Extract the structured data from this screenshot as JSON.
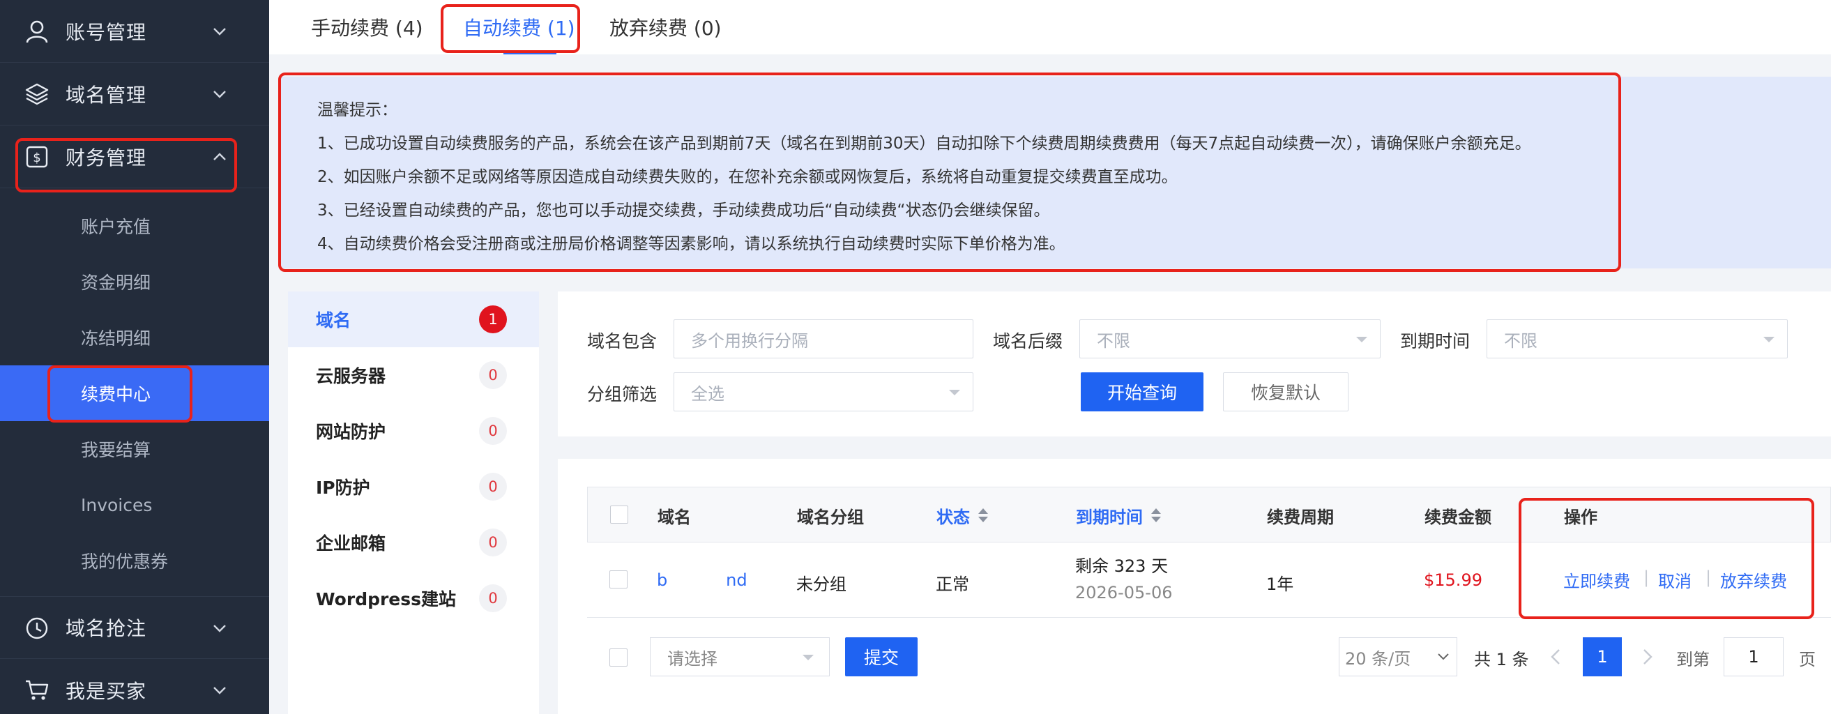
{
  "sidebar": {
    "sections": [
      {
        "label": "账号管理",
        "icon": "user-icon"
      },
      {
        "label": "域名管理",
        "icon": "layers-icon"
      },
      {
        "label": "财务管理",
        "icon": "finance-icon"
      },
      {
        "label": "域名抢注",
        "icon": "clock-icon"
      },
      {
        "label": "我是买家",
        "icon": "cart-icon"
      }
    ],
    "finance_items": [
      "账户充值",
      "资金明细",
      "冻结明细",
      "续费中心",
      "我要结算",
      "Invoices",
      "我的优惠券"
    ],
    "active_item": "续费中心"
  },
  "tabs": [
    {
      "label": "手动续费 (4)"
    },
    {
      "label": "自动续费 (1)"
    },
    {
      "label": "放弃续费 (0)"
    }
  ],
  "notice": {
    "title": "温馨提示：",
    "lines": [
      "1、已成功设置自动续费服务的产品，系统会在该产品到期前7天（域名在到期前30天）自动扣除下个续费周期续费费用（每天7点起自动续费一次），请确保账户余额充足。",
      "2、如因账户余额不足或网络等原因造成自动续费失败的，在您补充余额或网恢复后，系统将自动重复提交续费直至成功。",
      "3、已经设置自动续费的产品，您也可以手动提交续费，手动续费成功后“自动续费“状态仍会继续保留。",
      "4、自动续费价格会受注册商或注册局价格调整等因素影响，请以系统执行自动续费时实际下单价格为准。"
    ]
  },
  "categories": [
    {
      "label": "域名",
      "count": "1"
    },
    {
      "label": "云服务器",
      "count": "0"
    },
    {
      "label": "网站防护",
      "count": "0"
    },
    {
      "label": "IP防护",
      "count": "0"
    },
    {
      "label": "企业邮箱",
      "count": "0"
    },
    {
      "label": "Wordpress建站",
      "count": "0"
    }
  ],
  "filter": {
    "domain_contains_label": "域名包含",
    "domain_contains_placeholder": "多个用换行分隔",
    "suffix_label": "域名后缀",
    "suffix_value": "不限",
    "expire_label": "到期时间",
    "expire_value": "不限",
    "group_label": "分组筛选",
    "group_value": "全选",
    "search_button": "开始查询",
    "reset_button": "恢复默认"
  },
  "table": {
    "headers": {
      "domain": "域名",
      "group": "域名分组",
      "status": "状态",
      "expire": "到期时间",
      "period": "续费周期",
      "amount": "续费金额",
      "actions": "操作"
    },
    "rows": [
      {
        "domain": "b           nd",
        "group": "未分组",
        "status": "正常",
        "remaining": "剩余 323 天",
        "expire_date": "2026-05-06",
        "period": "1年",
        "amount": "$15.99",
        "action_renew": "立即续费",
        "action_cancel": "取消",
        "action_abandon": "放弃续费",
        "separator": "|"
      }
    ]
  },
  "footer": {
    "bulk_placeholder": "请选择",
    "submit_button": "提交",
    "page_size": "20 条/页",
    "total": "共 1 条",
    "current_page": "1",
    "goto_label": "到第",
    "goto_value": "1",
    "page_suffix": "页"
  },
  "colors": {
    "sidebar_bg": "#232c3b",
    "accent": "#2f6bf4",
    "active_item_bg": "#3a6af5",
    "notice_bg": "#e1e8fb",
    "price_red": "#e0141e",
    "highlight_red": "#e8221b"
  }
}
